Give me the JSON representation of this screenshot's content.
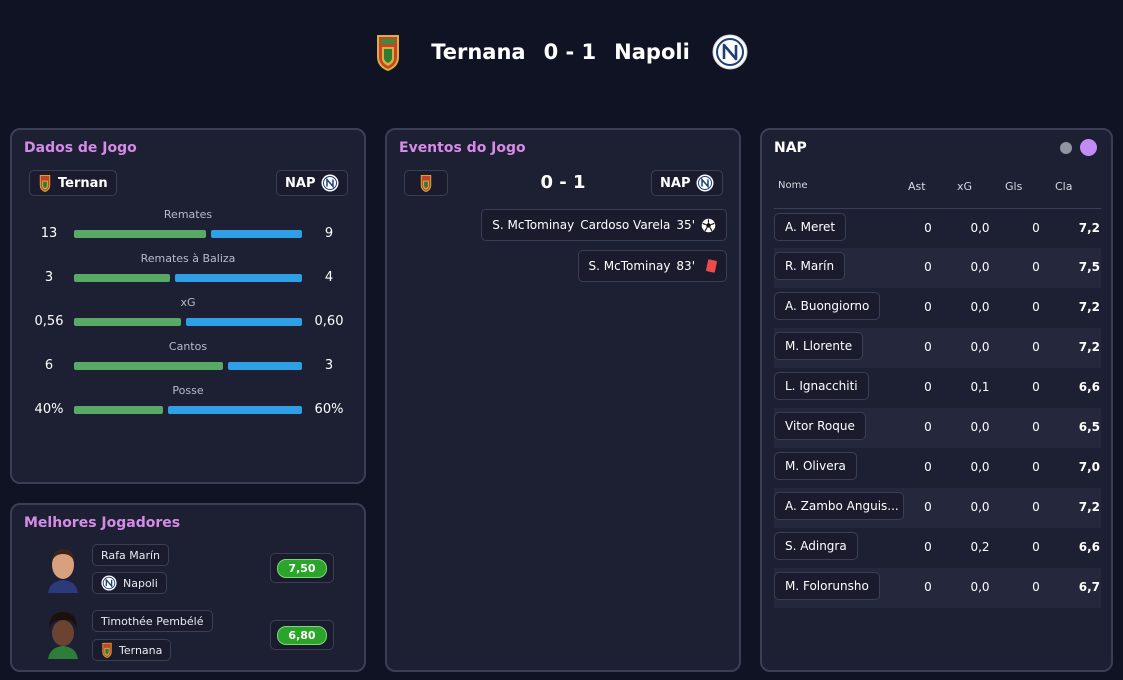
{
  "match": {
    "home_team": "Ternana",
    "away_team": "Napoli",
    "score": "0 - 1"
  },
  "stats_panel": {
    "title": "Dados de Jogo",
    "home_chip": "Ternan",
    "away_chip": "NAP",
    "stats": [
      {
        "label": "Remates",
        "home": "13",
        "away": "9",
        "home_share": 0.59
      },
      {
        "label": "Remates à Baliza",
        "home": "3",
        "away": "4",
        "home_share": 0.43
      },
      {
        "label": "xG",
        "home": "0,56",
        "away": "0,60",
        "home_share": 0.48
      },
      {
        "label": "Cantos",
        "home": "6",
        "away": "3",
        "home_share": 0.67
      },
      {
        "label": "Posse",
        "home": "40%",
        "away": "60%",
        "home_share": 0.4
      }
    ]
  },
  "best_players": {
    "title": "Melhores Jogadores",
    "players": [
      {
        "name": "Rafa Marín",
        "team": "Napoli",
        "rating": "7,50"
      },
      {
        "name": "Timothée Pembélé",
        "team": "Ternana",
        "rating": "6,80"
      }
    ]
  },
  "events_panel": {
    "title": "Eventos do Jogo",
    "score": "0 - 1",
    "away_chip": "NAP",
    "events": [
      {
        "player": "S. McTominay",
        "assist": "Cardoso Varela",
        "minute": "35'",
        "type": "goal-icon"
      },
      {
        "player": "S. McTominay",
        "assist": "",
        "minute": "83'",
        "type": "red-card-icon"
      }
    ]
  },
  "ratings_panel": {
    "title": "NAP",
    "columns": [
      "Nome",
      "Ast",
      "xG",
      "Gls",
      "Cla"
    ],
    "rows": [
      {
        "name": "A. Meret",
        "ast": "0",
        "xg": "0,0",
        "gls": "0",
        "cla": "7,2"
      },
      {
        "name": "R. Marín",
        "ast": "0",
        "xg": "0,0",
        "gls": "0",
        "cla": "7,5"
      },
      {
        "name": "A. Buongiorno",
        "ast": "0",
        "xg": "0,0",
        "gls": "0",
        "cla": "7,2"
      },
      {
        "name": "M. Llorente",
        "ast": "0",
        "xg": "0,0",
        "gls": "0",
        "cla": "7,2"
      },
      {
        "name": "L. Ignacchiti",
        "ast": "0",
        "xg": "0,1",
        "gls": "0",
        "cla": "6,6"
      },
      {
        "name": "Vitor Roque",
        "ast": "0",
        "xg": "0,0",
        "gls": "0",
        "cla": "6,5"
      },
      {
        "name": "M. Olivera",
        "ast": "0",
        "xg": "0,0",
        "gls": "0",
        "cla": "7,0"
      },
      {
        "name": "A. Zambo Anguis...",
        "ast": "0",
        "xg": "0,0",
        "gls": "0",
        "cla": "7,2"
      },
      {
        "name": "S. Adingra",
        "ast": "0",
        "xg": "0,2",
        "gls": "0",
        "cla": "6,6"
      },
      {
        "name": "M. Folorunsho",
        "ast": "0",
        "xg": "0,0",
        "gls": "0",
        "cla": "6,7"
      }
    ]
  },
  "colors": {
    "accent_title": "#d58ce6",
    "home_bar": "#58a866",
    "away_bar": "#2f9fe6",
    "rating_pill": "#2aa52a",
    "red_card": "#f04949",
    "toggle_active": "#c38cf5",
    "toggle_inactive": "#8e96a1"
  }
}
